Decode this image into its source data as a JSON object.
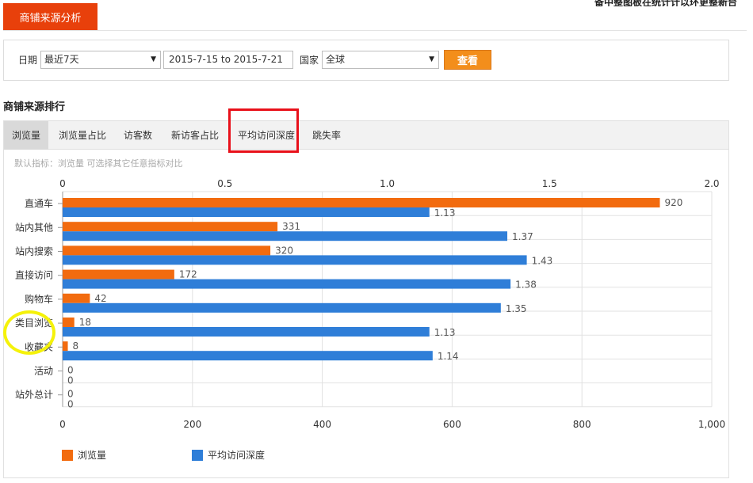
{
  "page": {
    "top_tab": "商铺来源分析",
    "header_note": "备中整图板在统计计以环更整新台"
  },
  "filters": {
    "date_label": "日期",
    "period_value": "最近7天",
    "date_range": "2015-7-15 to 2015-7-21",
    "country_label": "国家",
    "country_value": "全球",
    "view_button": "查看"
  },
  "section": {
    "title": "商铺来源排行",
    "tabs": [
      {
        "label": "浏览量",
        "active": true
      },
      {
        "label": "浏览量占比",
        "active": false
      },
      {
        "label": "访客数",
        "active": false
      },
      {
        "label": "新访客占比",
        "active": false
      },
      {
        "label": "平均访问深度",
        "active": false
      },
      {
        "label": "跳失率",
        "active": false
      }
    ],
    "hint": "默认指标：浏览量 可选择其它任意指标对比"
  },
  "colors": {
    "orange": "#f26b0f",
    "blue": "#2f7ed8",
    "accent_red": "#e8400b",
    "button_orange": "#f38e1b"
  },
  "chart_data": {
    "type": "bar",
    "orientation": "horizontal",
    "categories": [
      "直通车",
      "站内其他",
      "站内搜索",
      "直接访问",
      "购物车",
      "类目浏览",
      "收藏夹",
      "活动",
      "站外总计"
    ],
    "series": [
      {
        "name": "浏览量",
        "axis": "bottom",
        "color": "#f26b0f",
        "values": [
          920,
          331,
          320,
          172,
          42,
          18,
          8,
          0,
          0
        ],
        "labels": [
          "920",
          "331",
          "320",
          "172",
          "42",
          "18",
          "8",
          "0",
          "0"
        ]
      },
      {
        "name": "平均访问深度",
        "axis": "top",
        "color": "#2f7ed8",
        "values": [
          1.13,
          1.37,
          1.43,
          1.38,
          1.35,
          1.13,
          1.14,
          0,
          0
        ],
        "labels": [
          "1.13",
          "1.37",
          "1.43",
          "1.38",
          "1.35",
          "1.13",
          "1.14",
          "0",
          "0"
        ]
      }
    ],
    "top_axis": {
      "range": [
        0,
        2.0
      ],
      "ticks": [
        "0",
        "0.5",
        "1.0",
        "1.5",
        "2.0"
      ]
    },
    "bottom_axis": {
      "range": [
        0,
        1000
      ],
      "ticks": [
        "0",
        "200",
        "400",
        "600",
        "800",
        "1,000"
      ]
    },
    "grid": true,
    "legend_position": "bottom-left"
  }
}
